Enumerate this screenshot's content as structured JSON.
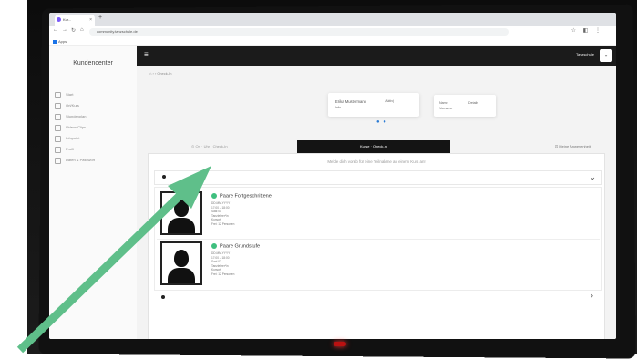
{
  "browser": {
    "tab_title": "Kur...",
    "url": "community.tanzschule.de",
    "bookmark": "Apps"
  },
  "app": {
    "brand": "Kundencenter",
    "user_name": "Tanzschule",
    "sidebar": {
      "items": [
        {
          "label": "Start",
          "icon": "home-icon"
        },
        {
          "label": "Ort/Kurs",
          "icon": "location-icon"
        },
        {
          "label": "Stundenplan",
          "icon": "calendar-icon"
        },
        {
          "label": "Videos/Clips",
          "icon": "video-icon"
        },
        {
          "label": "Infopoint",
          "icon": "info-icon"
        },
        {
          "label": "Profil",
          "icon": "user-icon"
        },
        {
          "label": "Daten & Passwort",
          "icon": "lock-icon"
        }
      ]
    },
    "breadcrumb": "⌂  ›  ›  Check-In",
    "cards": {
      "card1_title": "Erika Mustermann",
      "card1_sub": "Info",
      "card1_meta": "(Aktiv)",
      "card2_title": "Name",
      "card2_sub": "Vorname",
      "card2_meta": "Details"
    },
    "filter": {
      "left": "⊙ Ort · Uhr · Check-In",
      "button": "Kurse · Check-In",
      "right": "⊡ Meine Anwesenheit"
    },
    "notice": "Melde dich vorab für eine Teilnahme an einem Kurs an!",
    "courses": [
      {
        "title": "Paare Fortgeschrittene",
        "details": [
          "DD.MM.YYYY",
          "17:00 – 18:00",
          "Saal 01",
          "Tanzlehrer*in",
          "Kursort",
          "Frei: 12 Personen"
        ]
      },
      {
        "title": "Paare Grundstufe",
        "details": [
          "DD.MM.YYYY",
          "17:00 – 18:00",
          "Saal 02",
          "Tanzlehrer*in",
          "Kursort",
          "Frei: 12 Personen"
        ]
      }
    ]
  },
  "colors": {
    "arrow": "#5fbf8a",
    "status": "#3fbf7f",
    "nav": "#1b1b1b"
  }
}
